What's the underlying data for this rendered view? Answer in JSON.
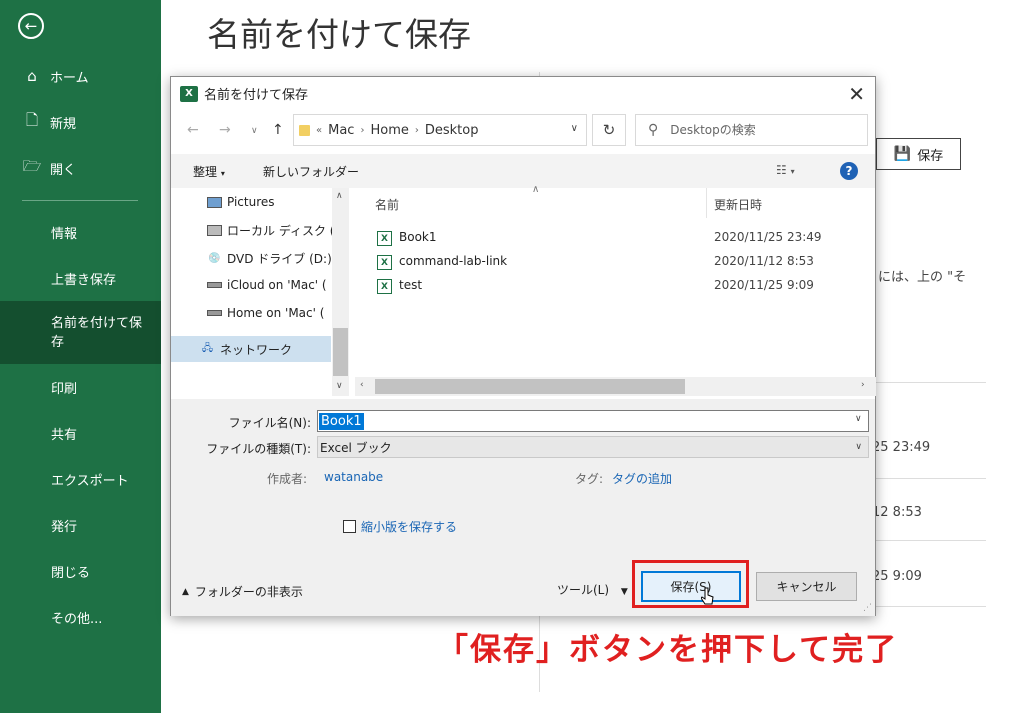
{
  "backstage": {
    "title": "名前を付けて保存",
    "nav": {
      "home": "ホーム",
      "new": "新規",
      "open": "開く",
      "info": "情報",
      "save": "上書き保存",
      "save_as_line1": "名前を付けて保",
      "save_as_line2": "存",
      "print": "印刷",
      "share": "共有",
      "export": "エクスポート",
      "publish": "発行",
      "close": "閉じる",
      "more": "その他..."
    },
    "save_button": "保存",
    "hint_text": "には、上の \"そ",
    "dates": [
      "25 23:49",
      "12 8:53",
      "25 9:09"
    ]
  },
  "dialog": {
    "title": "名前を付けて保存",
    "address": {
      "parts": [
        "Mac",
        "Home",
        "Desktop"
      ],
      "search_placeholder": "Desktopの検索"
    },
    "toolbar": {
      "organize": "整理",
      "new_folder": "新しいフォルダー"
    },
    "tree": [
      {
        "label": "Pictures",
        "icon": "pictures-icon"
      },
      {
        "label": "ローカル ディスク (C:",
        "icon": "disk-icon"
      },
      {
        "label": "DVD ドライブ (D:) (",
        "icon": "dvd-icon"
      },
      {
        "label": "iCloud on 'Mac' (",
        "icon": "network-drive-icon"
      },
      {
        "label": "Home on 'Mac' (",
        "icon": "network-drive-icon"
      },
      {
        "label": "ネットワーク",
        "icon": "network-icon"
      }
    ],
    "columns": {
      "name": "名前",
      "modified": "更新日時"
    },
    "files": [
      {
        "name": "Book1",
        "date": "2020/11/25 23:49"
      },
      {
        "name": "command-lab-link",
        "date": "2020/11/12 8:53"
      },
      {
        "name": "test",
        "date": "2020/11/25 9:09"
      }
    ],
    "form": {
      "filename_label": "ファイル名(N):",
      "filename_value": "Book1",
      "filetype_label": "ファイルの種類(T):",
      "filetype_value": "Excel ブック",
      "author_label": "作成者:",
      "author_value": "watanabe",
      "tags_label": "タグ:",
      "tags_value": "タグの追加",
      "thumbnail_label": "縮小版を保存する",
      "hide_folders": "フォルダーの非表示",
      "tools": "ツール(L)",
      "save": "保存(S)",
      "cancel": "キャンセル"
    }
  },
  "annotation": "「保存」ボタンを押下して完了",
  "colors": {
    "sidebar": "#1e7145",
    "sidebar_selected": "#144f2f",
    "highlight": "#e02020",
    "accent": "#0078d7"
  }
}
